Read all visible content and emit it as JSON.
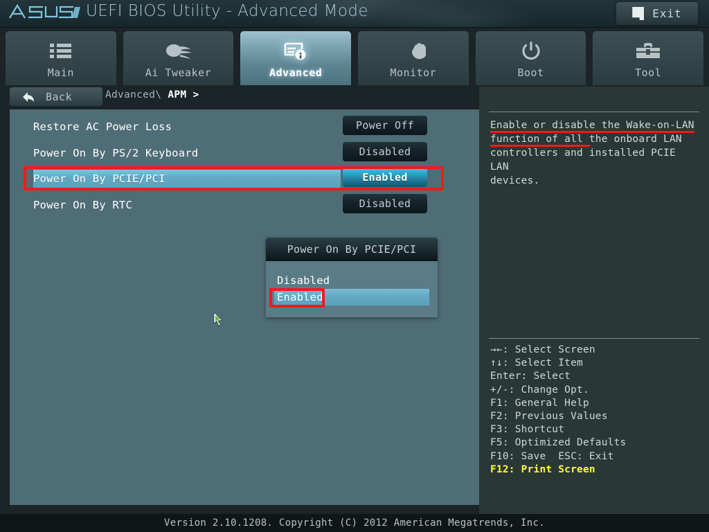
{
  "header": {
    "logo_text": "ASUS",
    "title": "UEFI BIOS Utility - Advanced Mode",
    "exit_label": "Exit",
    "exit_icon": "door-exit-icon"
  },
  "tabs": [
    {
      "label": "Main",
      "icon": "list-icon",
      "active": false
    },
    {
      "label": "Ai Tweaker",
      "icon": "turbo-fan-icon",
      "active": false
    },
    {
      "label": "Advanced",
      "icon": "monitor-info-icon",
      "active": true
    },
    {
      "label": "Monitor",
      "icon": "gauge-temp-icon",
      "active": false
    },
    {
      "label": "Boot",
      "icon": "power-icon",
      "active": false
    },
    {
      "label": "Tool",
      "icon": "toolbox-icon",
      "active": false
    }
  ],
  "navigation": {
    "back_label": "Back",
    "back_icon": "arrow-left-icon",
    "breadcrumb_parent": "Advanced\\",
    "breadcrumb_current": "APM",
    "breadcrumb_separator": ">"
  },
  "settings": [
    {
      "label": "Restore AC Power Loss",
      "value": "Power Off",
      "selected": false
    },
    {
      "label": "Power On By PS/2 Keyboard",
      "value": "Disabled",
      "selected": false
    },
    {
      "label": "Power On By PCIE/PCI",
      "value": "Enabled",
      "selected": true
    },
    {
      "label": "Power On By RTC",
      "value": "Disabled",
      "selected": false
    }
  ],
  "dropdown": {
    "title": "Power On By PCIE/PCI",
    "options": [
      {
        "label": "Disabled",
        "selected": false
      },
      {
        "label": "Enabled",
        "selected": true
      }
    ]
  },
  "help": {
    "lines": [
      "Enable or disable the Wake-on-LAN",
      "function of all the onboard LAN",
      "controllers and installed PCIE LAN",
      "devices."
    ]
  },
  "legend": {
    "lines": [
      {
        "text": "→←: Select Screen",
        "highlight": false
      },
      {
        "text": "↑↓: Select Item",
        "highlight": false
      },
      {
        "text": "Enter: Select",
        "highlight": false
      },
      {
        "text": "+/-: Change Opt.",
        "highlight": false
      },
      {
        "text": "F1: General Help",
        "highlight": false
      },
      {
        "text": "F2: Previous Values",
        "highlight": false
      },
      {
        "text": "F3: Shortcut",
        "highlight": false
      },
      {
        "text": "F5: Optimized Defaults",
        "highlight": false
      },
      {
        "text": "F10: Save  ESC: Exit",
        "highlight": false
      },
      {
        "text": "F12: Print Screen",
        "highlight": true
      }
    ]
  },
  "footer": {
    "text": "Version 2.10.1208. Copyright (C) 2012 American Megatrends, Inc."
  },
  "colors": {
    "accent_cyan": "#49c2e8",
    "annotation_red": "#f5191b",
    "highlight_yellow": "#ffff33",
    "panel_bg": "#4f6d77",
    "help_panel_bg": "#2a3835"
  }
}
